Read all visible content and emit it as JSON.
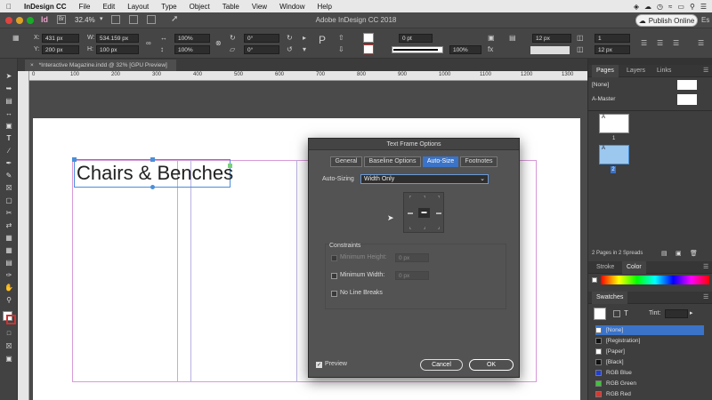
{
  "menubar": {
    "app": "InDesign CC",
    "items": [
      "File",
      "Edit",
      "Layout",
      "Type",
      "Object",
      "Table",
      "View",
      "Window",
      "Help"
    ]
  },
  "appbar": {
    "title": "Adobe InDesign CC 2018",
    "zoom": "32.4%",
    "publish_label": "Publish Online",
    "workspace_abbr": "Es"
  },
  "control": {
    "x_label": "X:",
    "x_value": "431 px",
    "y_label": "Y:",
    "y_value": "200 px",
    "w_label": "W:",
    "w_value": "534.159 px",
    "h_label": "H:",
    "h_value": "100 px",
    "scale_x": "100%",
    "scale_y": "100%",
    "rotate": "0°",
    "shear": "0°",
    "stroke_weight": "0 pt",
    "opacity": "100%",
    "size_field": "12 px",
    "columns": "1",
    "gutter": "12 px"
  },
  "document": {
    "tab_label": "*Interactive Magazine.indd @ 32% [GPU Preview]",
    "ruler_marks": [
      "0",
      "100",
      "200",
      "300",
      "400",
      "500",
      "600",
      "700",
      "800",
      "900",
      "1000",
      "1100",
      "1200",
      "1300"
    ],
    "heading": "Chairs & Benches"
  },
  "dialog": {
    "title": "Text Frame Options",
    "tabs": [
      "General",
      "Baseline Options",
      "Auto-Size",
      "Footnotes"
    ],
    "active_tab": "Auto-Size",
    "auto_sizing_label": "Auto-Sizing",
    "auto_sizing_value": "Width Only",
    "constraints_title": "Constraints",
    "min_height_label": "Minimum Height:",
    "min_height_value": "0 px",
    "min_width_label": "Minimum Width:",
    "min_width_value": "0 px",
    "no_line_breaks_label": "No Line Breaks",
    "preview_label": "Preview",
    "preview_checked": true,
    "cancel_label": "Cancel",
    "ok_label": "OK"
  },
  "pages_panel": {
    "tabs": [
      "Pages",
      "Layers",
      "Links"
    ],
    "none_label": "[None]",
    "master_label": "A-Master",
    "page1_number": "1",
    "page2_number": "2",
    "page_letter": "A",
    "footer": "2 Pages in 2 Spreads"
  },
  "stroke_color_panel": {
    "tabs": [
      "Stroke",
      "Color"
    ]
  },
  "swatches_panel": {
    "title": "Swatches",
    "tint_label": "Tint:",
    "tint_value": "",
    "swatches": [
      {
        "name": "[None]",
        "color": "#ffffff",
        "selected": true
      },
      {
        "name": "[Registration]",
        "color": "#111111"
      },
      {
        "name": "[Paper]",
        "color": "#ffffff"
      },
      {
        "name": "[Black]",
        "color": "#111111"
      },
      {
        "name": "RGB Blue",
        "color": "#1f3fd8"
      },
      {
        "name": "RGB Green",
        "color": "#3ec43a"
      },
      {
        "name": "RGB Red",
        "color": "#e0332b"
      }
    ]
  },
  "colors": {
    "accent": "#3a73c8",
    "selection_blue": "#4a8fd8"
  }
}
